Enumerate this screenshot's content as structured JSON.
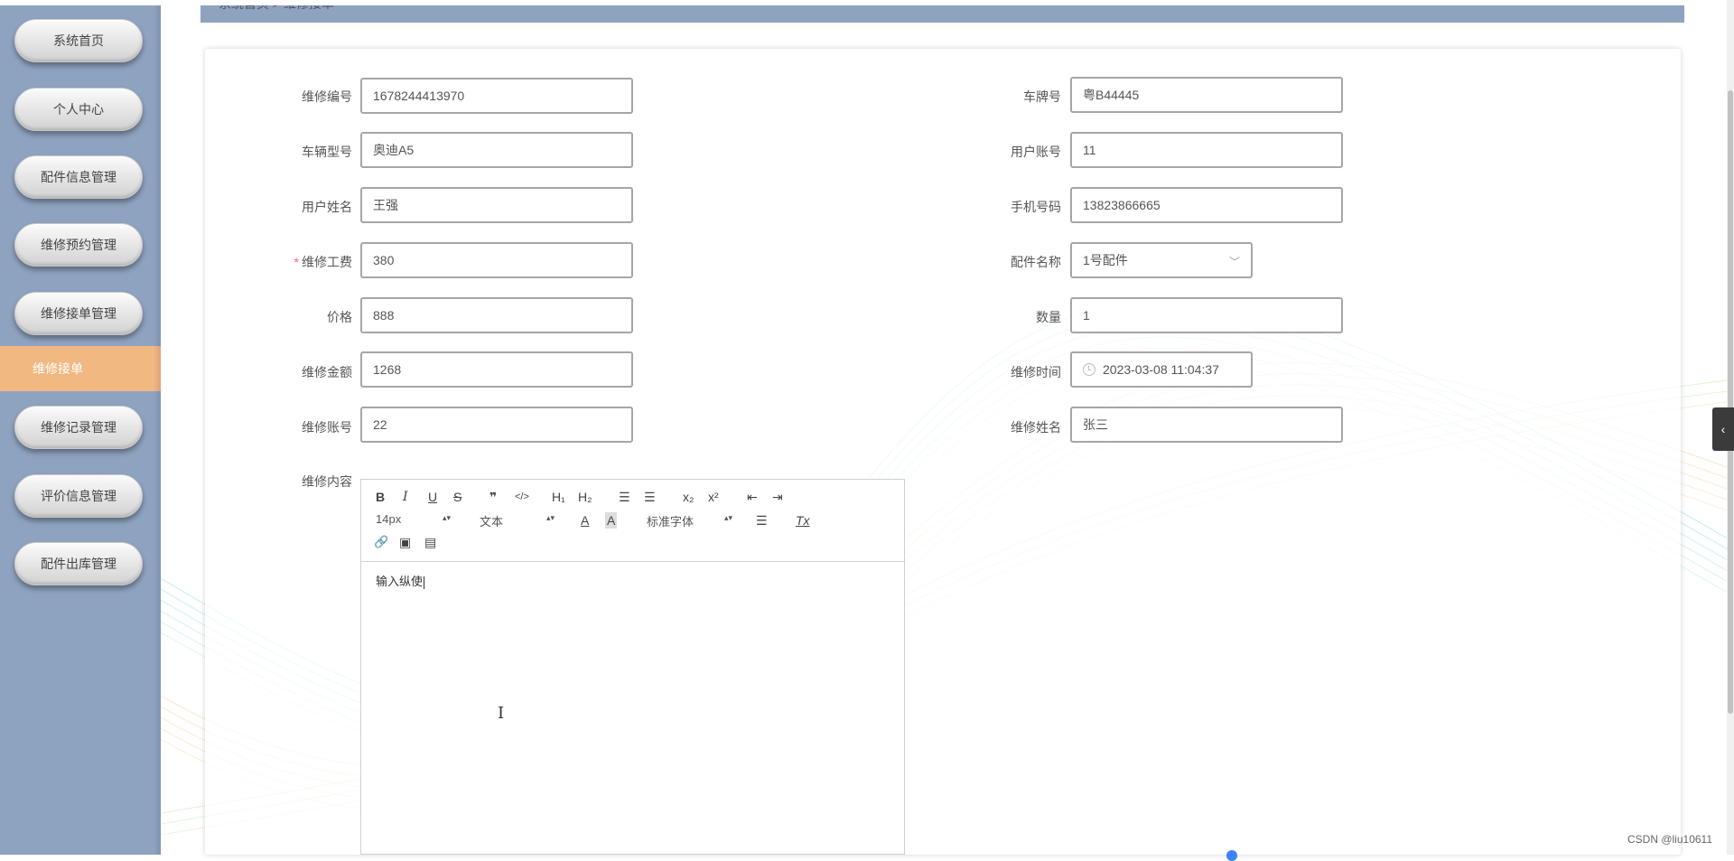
{
  "sidebar": {
    "items": [
      {
        "label": "系统首页"
      },
      {
        "label": "个人中心"
      },
      {
        "label": "配件信息管理"
      },
      {
        "label": "维修预约管理"
      },
      {
        "label": "维修接单管理"
      },
      {
        "label": "维修记录管理"
      },
      {
        "label": "评价信息管理"
      },
      {
        "label": "配件出库管理"
      }
    ],
    "active_sub": "维修接单"
  },
  "breadcrumb": "系统首页 > 维修接单",
  "form": {
    "repair_no": {
      "label": "维修编号",
      "value": "1678244413970"
    },
    "plate_no": {
      "label": "车牌号",
      "value": "粤B44445"
    },
    "vehicle_model": {
      "label": "车辆型号",
      "value": "奥迪A5"
    },
    "user_account": {
      "label": "用户账号",
      "value": "11"
    },
    "user_name": {
      "label": "用户姓名",
      "value": "王强"
    },
    "phone": {
      "label": "手机号码",
      "value": "13823866665"
    },
    "labor_fee": {
      "label": "维修工费",
      "value": "380",
      "required_mark": "*"
    },
    "part_name": {
      "label": "配件名称",
      "value": "1号配件"
    },
    "price": {
      "label": "价格",
      "value": "888"
    },
    "quantity": {
      "label": "数量",
      "value": "1"
    },
    "amount": {
      "label": "维修金额",
      "value": "1268"
    },
    "repair_time": {
      "label": "维修时间",
      "value": "2023-03-08 11:04:37"
    },
    "repair_account": {
      "label": "维修账号",
      "value": "22"
    },
    "repairer_name": {
      "label": "维修姓名",
      "value": "张三"
    },
    "content": {
      "label": "维修内容",
      "text": "输入纵使"
    }
  },
  "editor_toolbar": {
    "bold": "B",
    "italic": "I",
    "underline": "U",
    "strike": "S",
    "quote": "❞",
    "code": "</>",
    "h1": "H₁",
    "h2": "H₂",
    "ordered_list": "☰",
    "bullet_list": "☰",
    "sub": "x₂",
    "sup": "x²",
    "outdent": "⇤",
    "indent": "⇥",
    "size": "14px",
    "header": "文本",
    "font": "标准字体",
    "color": "A",
    "background": "A",
    "align": "☰",
    "clean": "Tx",
    "link": "🔗",
    "image": "▣",
    "video": "▤"
  },
  "watermark": "CSDN @liu10611",
  "colors": {
    "sidebar": "#8ea3c0",
    "active": "#f2b882",
    "required": "#f56c6c"
  }
}
